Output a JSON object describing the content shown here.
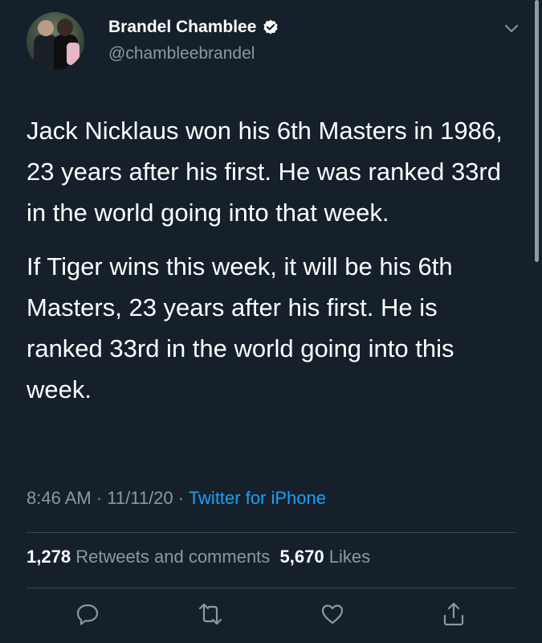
{
  "author": {
    "name": "Brandel Chamblee",
    "handle": "@chambleebrandel"
  },
  "tweet": {
    "paragraphs": [
      "Jack Nicklaus won his 6th Masters in 1986, 23 years after his first. He was ranked 33rd in the world going into that week.",
      "If Tiger wins this week, it will be his 6th Masters, 23 years after his first. He is ranked 33rd in the world going into this week."
    ]
  },
  "meta": {
    "time": "8:46 AM",
    "sep1": " · ",
    "date": "11/11/20",
    "sep2": " · ",
    "source": "Twitter for iPhone"
  },
  "stats": {
    "retweets_count": "1,278",
    "retweets_label": "Retweets and comments",
    "likes_count": "5,670",
    "likes_label": "Likes"
  },
  "icons": {
    "verified": "verified-badge-icon",
    "more": "chevron-down-icon",
    "reply": "reply-icon",
    "retweet": "retweet-icon",
    "like": "heart-icon",
    "share": "share-icon"
  },
  "colors": {
    "background": "#15202b",
    "secondary_text": "#8899a6",
    "link": "#1da1f2",
    "divider": "#38444d"
  }
}
